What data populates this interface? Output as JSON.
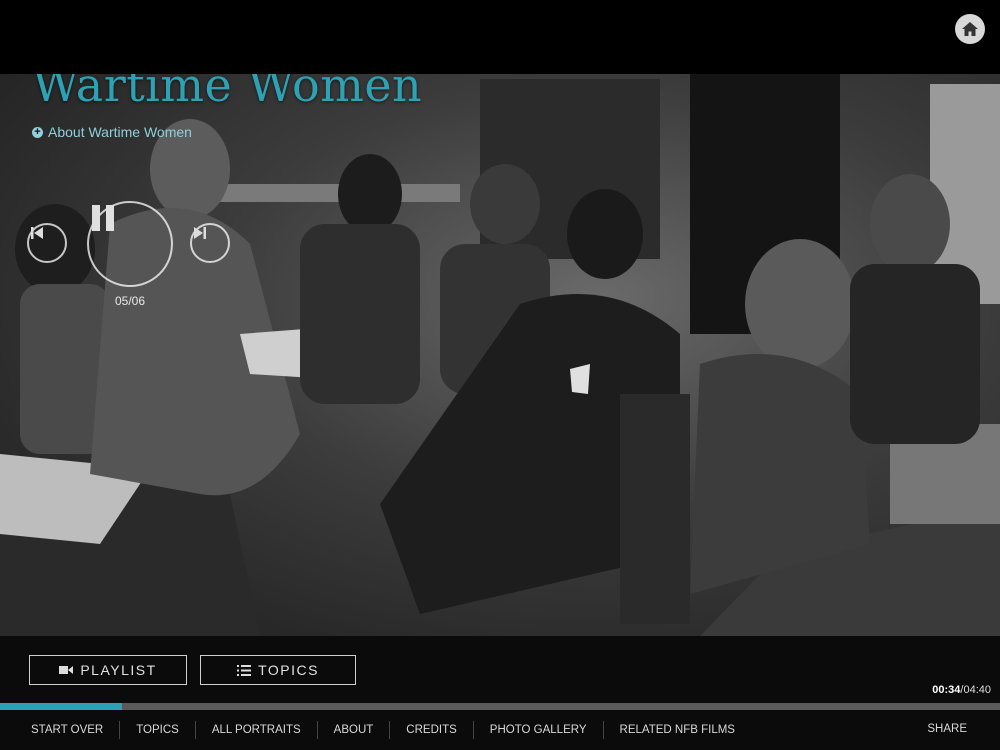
{
  "header": {
    "home_icon": "home-icon"
  },
  "hero": {
    "title": "Wartime Women",
    "about_label": "About Wartime Women",
    "photo_alt": "Black and white photograph of an office with women and a man working at desks"
  },
  "player": {
    "counter": "05/06",
    "prev_icon": "skip-back-icon",
    "pause_icon": "pause-icon",
    "next_icon": "skip-forward-icon"
  },
  "footer": {
    "playlist_label": "PLAYLIST",
    "topics_label": "TOPICS",
    "time_current": "00:34",
    "time_separator": "/",
    "time_total": "04:40",
    "progress": 0.122,
    "nav": [
      "START OVER",
      "TOPICS",
      "ALL PORTRAITS",
      "ABOUT",
      "CREDITS",
      "PHOTO GALLERY",
      "RELATED NFB FILMS"
    ],
    "share_label": "SHARE"
  },
  "colors": {
    "accent": "#2ea2b5",
    "background": "#000000"
  }
}
